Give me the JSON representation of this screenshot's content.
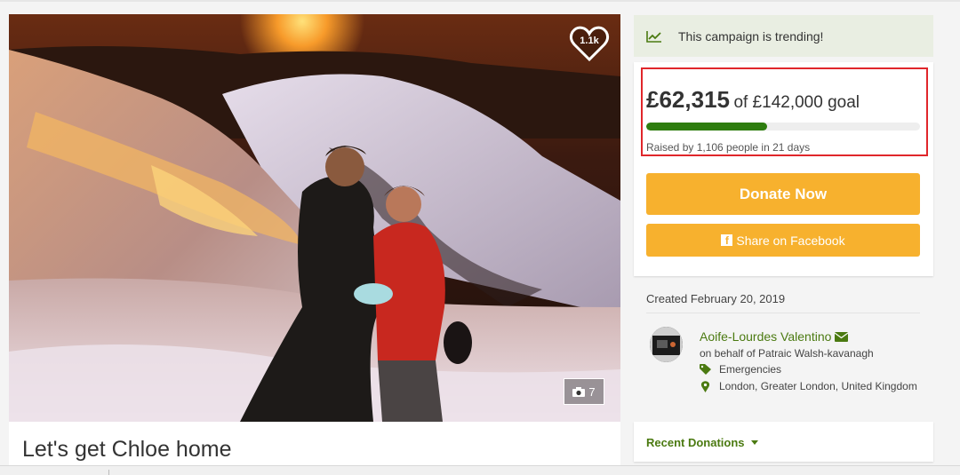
{
  "campaign": {
    "title": "Let's get Chloe home",
    "likes": "1.1k",
    "photo_count": "7"
  },
  "trending": {
    "text": "This campaign is trending!",
    "icon": "trend-chart-icon"
  },
  "progress": {
    "raised": "£62,315",
    "goal_text": "of £142,000 goal",
    "fraction": 0.44,
    "raised_by": "Raised by 1,106 people in 21 days"
  },
  "actions": {
    "donate_label": "Donate Now",
    "share_label": "Share on Facebook"
  },
  "details": {
    "created": "Created February 20, 2019",
    "organizer": "Aoife-Lourdes Valentino",
    "on_behalf": "on behalf of Patraic Walsh-kavanagh",
    "category": "Emergencies",
    "location": "London, Greater London, United Kingdom"
  },
  "recent": {
    "label": "Recent Donations"
  },
  "colors": {
    "accent_green": "#4b7a11",
    "progress_green": "#2e7d0f",
    "button_yellow": "#f7b12e",
    "highlight_red": "#e0262b"
  }
}
